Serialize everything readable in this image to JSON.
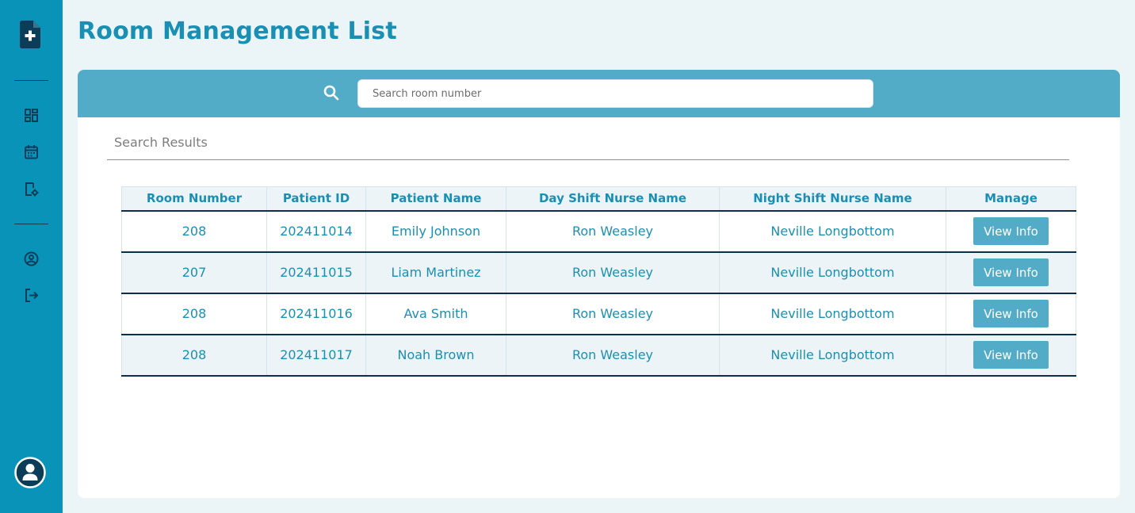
{
  "app": {
    "icons": {
      "logo": "medical-file-plus-icon",
      "dashboard": "dashboard-grid-icon",
      "calendar": "calendar-icon",
      "room_settings": "room-settings-icon",
      "profile": "user-circle-icon",
      "logout": "logout-icon",
      "avatar": "user-avatar-icon",
      "search": "search-icon"
    },
    "colors": {
      "sidebar": "#0a93b8",
      "accent": "#1a8fb4",
      "search_bar": "#53acc7",
      "button": "#53acc7",
      "row_alt": "#edf4f7",
      "row_divider": "#0c2f48"
    }
  },
  "page": {
    "title": "Room Management List"
  },
  "search": {
    "placeholder": "Search room number",
    "value": ""
  },
  "results": {
    "label": "Search Results",
    "columns": [
      "Room Number",
      "Patient ID",
      "Patient Name",
      "Day Shift Nurse Name",
      "Night Shift Nurse Name",
      "Manage"
    ],
    "rows": [
      {
        "room": "208",
        "patient_id": "202411014",
        "patient_name": "Emily Johnson",
        "day_nurse": "Ron Weasley",
        "night_nurse": "Neville Longbottom",
        "action": "View Info"
      },
      {
        "room": "207",
        "patient_id": "202411015",
        "patient_name": "Liam Martinez",
        "day_nurse": "Ron Weasley",
        "night_nurse": "Neville Longbottom",
        "action": "View Info"
      },
      {
        "room": "208",
        "patient_id": "202411016",
        "patient_name": "Ava Smith",
        "day_nurse": "Ron Weasley",
        "night_nurse": "Neville Longbottom",
        "action": "View Info"
      },
      {
        "room": "208",
        "patient_id": "202411017",
        "patient_name": "Noah Brown",
        "day_nurse": "Ron Weasley",
        "night_nurse": "Neville Longbottom",
        "action": "View Info"
      }
    ]
  }
}
